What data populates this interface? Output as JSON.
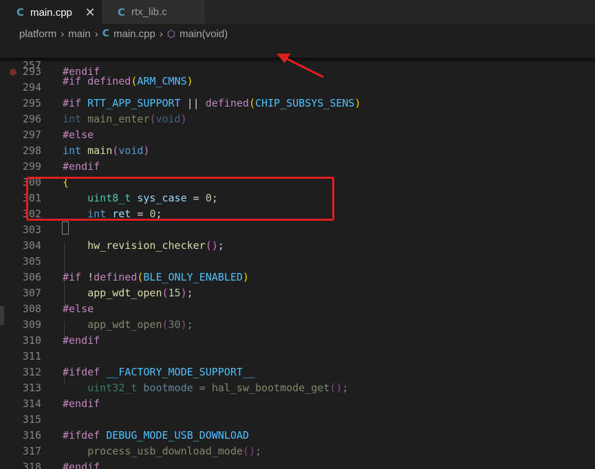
{
  "tabs": [
    {
      "label": "main.cpp",
      "icon": "c-plus-plus-icon",
      "active": true,
      "close": "✕"
    },
    {
      "label": "rtx_lib.c",
      "icon": "c-file-icon",
      "active": false
    }
  ],
  "breadcrumb": {
    "items": [
      "platform",
      "main",
      "main.cpp",
      "main(void)"
    ]
  },
  "sticky": {
    "ln": "257",
    "code": "#if defined(ARM_CMNS)"
  },
  "lines": [
    {
      "ln": "293",
      "code": "#endif"
    },
    {
      "ln": "294",
      "code": ""
    },
    {
      "ln": "295",
      "code": "#if RTT_APP_SUPPORT || defined(CHIP_SUBSYS_SENS)"
    },
    {
      "ln": "296",
      "code": "int main_enter(void)"
    },
    {
      "ln": "297",
      "code": "#else"
    },
    {
      "ln": "298",
      "code": "int main(void)"
    },
    {
      "ln": "299",
      "code": "#endif"
    },
    {
      "ln": "300",
      "code": "{"
    },
    {
      "ln": "301",
      "code": "    uint8_t sys_case = 0;"
    },
    {
      "ln": "302",
      "code": "    int ret = 0;"
    },
    {
      "ln": "303",
      "code": ""
    },
    {
      "ln": "304",
      "code": "    hw_revision_checker();"
    },
    {
      "ln": "305",
      "code": ""
    },
    {
      "ln": "306",
      "code": "#if !defined(BLE_ONLY_ENABLED)"
    },
    {
      "ln": "307",
      "code": "    app_wdt_open(15);"
    },
    {
      "ln": "308",
      "code": "#else"
    },
    {
      "ln": "309",
      "code": "    app_wdt_open(30);"
    },
    {
      "ln": "310",
      "code": "#endif"
    },
    {
      "ln": "311",
      "code": ""
    },
    {
      "ln": "312",
      "code": "#ifdef __FACTORY_MODE_SUPPORT__"
    },
    {
      "ln": "313",
      "code": "    uint32_t bootmode = hal_sw_bootmode_get();"
    },
    {
      "ln": "314",
      "code": "#endif"
    },
    {
      "ln": "315",
      "code": ""
    },
    {
      "ln": "316",
      "code": "#ifdef DEBUG_MODE_USB_DOWNLOAD"
    },
    {
      "ln": "317",
      "code": "    process_usb_download_mode();"
    },
    {
      "ln": "318",
      "code": "#endif"
    }
  ],
  "colors": {
    "annotation": "#e02020",
    "breakpoint": "#7c2b22",
    "background": "#1e1e1e"
  }
}
